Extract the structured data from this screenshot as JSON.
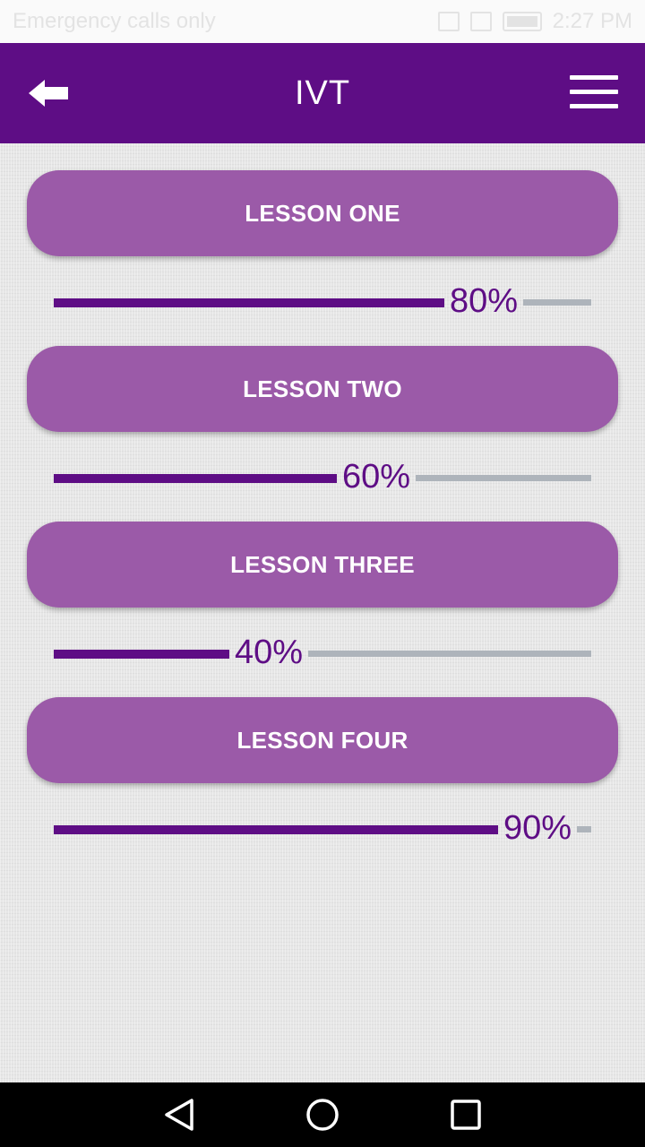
{
  "status_bar": {
    "carrier_text": "Emergency calls only",
    "time": "2:27 PM"
  },
  "app_bar": {
    "title": "IVT",
    "back_icon": "back-arrow-icon",
    "menu_icon": "hamburger-menu-icon"
  },
  "colors": {
    "primary": "#5e0d85",
    "button": "#9b5aa8",
    "track": "#aeb4bb"
  },
  "lessons": [
    {
      "label": "LESSON ONE",
      "progress": 0.8,
      "progress_label": "80%"
    },
    {
      "label": "LESSON TWO",
      "progress": 0.6,
      "progress_label": "60%"
    },
    {
      "label": "LESSON THREE",
      "progress": 0.4,
      "progress_label": "40%"
    },
    {
      "label": "LESSON FOUR",
      "progress": 0.9,
      "progress_label": "90%"
    }
  ],
  "nav_bar": {
    "back_icon": "nav-back-icon",
    "home_icon": "nav-home-icon",
    "recents_icon": "nav-recents-icon"
  }
}
